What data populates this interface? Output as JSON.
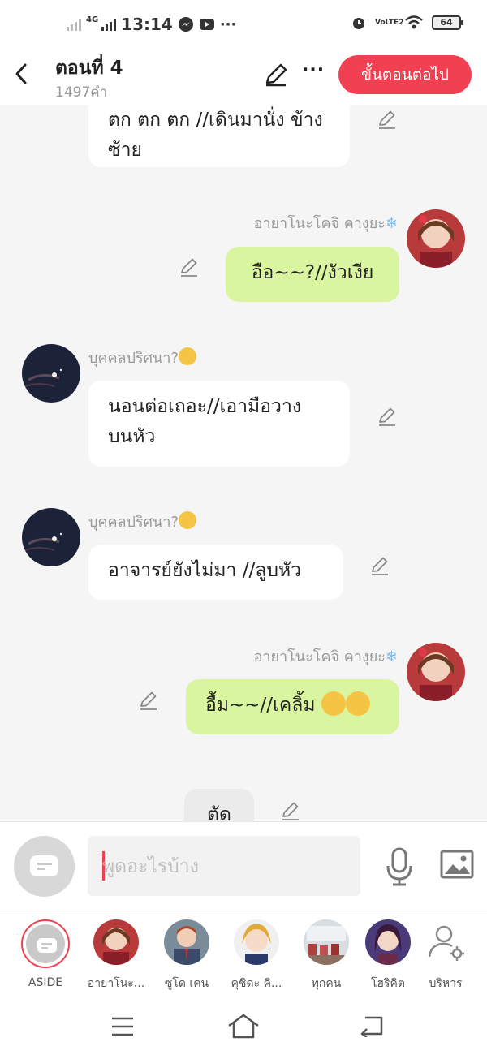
{
  "status_bar": {
    "network": "4G",
    "time": "13:14",
    "volte": "VoLTE2",
    "battery": "64"
  },
  "header": {
    "title": "ตอนที่ 4",
    "word_count": "1497คำ",
    "more_label": "···",
    "next_button": "ขั้นตอนต่อไป"
  },
  "messages": [
    {
      "speaker": "",
      "text": "ตก ตก ตก //เดินมานั่ง ข้างซ้าย",
      "side": "left"
    },
    {
      "speaker": "อายาโนะโคจิ คางุยะ",
      "text": "อือ~~?//งัวเงีย",
      "side": "right"
    },
    {
      "speaker": "บุคคลปริศนา?",
      "text": "นอนต่อเถอะ//เอามือวาง บนหัว",
      "side": "left"
    },
    {
      "speaker": "บุคคลปริศนา?",
      "text": "อาจารย์ยังไม่มา //ลูบหัว",
      "side": "left"
    },
    {
      "speaker": "อายาโนะโคจิ คางุยะ",
      "text": "อื้ม~~//เคลิ้ม",
      "side": "right"
    },
    {
      "speaker": "",
      "text": "ตัด",
      "side": "center"
    }
  ],
  "input": {
    "placeholder": "พูดอะไรบ้าง"
  },
  "characters": [
    {
      "label": "ASIDE"
    },
    {
      "label": "อายาโนะ..."
    },
    {
      "label": "ซูโด เคน"
    },
    {
      "label": "คุชิดะ คิ..."
    },
    {
      "label": "ทุกคน"
    },
    {
      "label": "โฮริคิต"
    },
    {
      "label": "บริหาร"
    }
  ],
  "colors": {
    "accent": "#f04052",
    "bubble_green": "#d9f5a0",
    "bubble_white": "#ffffff",
    "background": "#f5f5f5"
  }
}
